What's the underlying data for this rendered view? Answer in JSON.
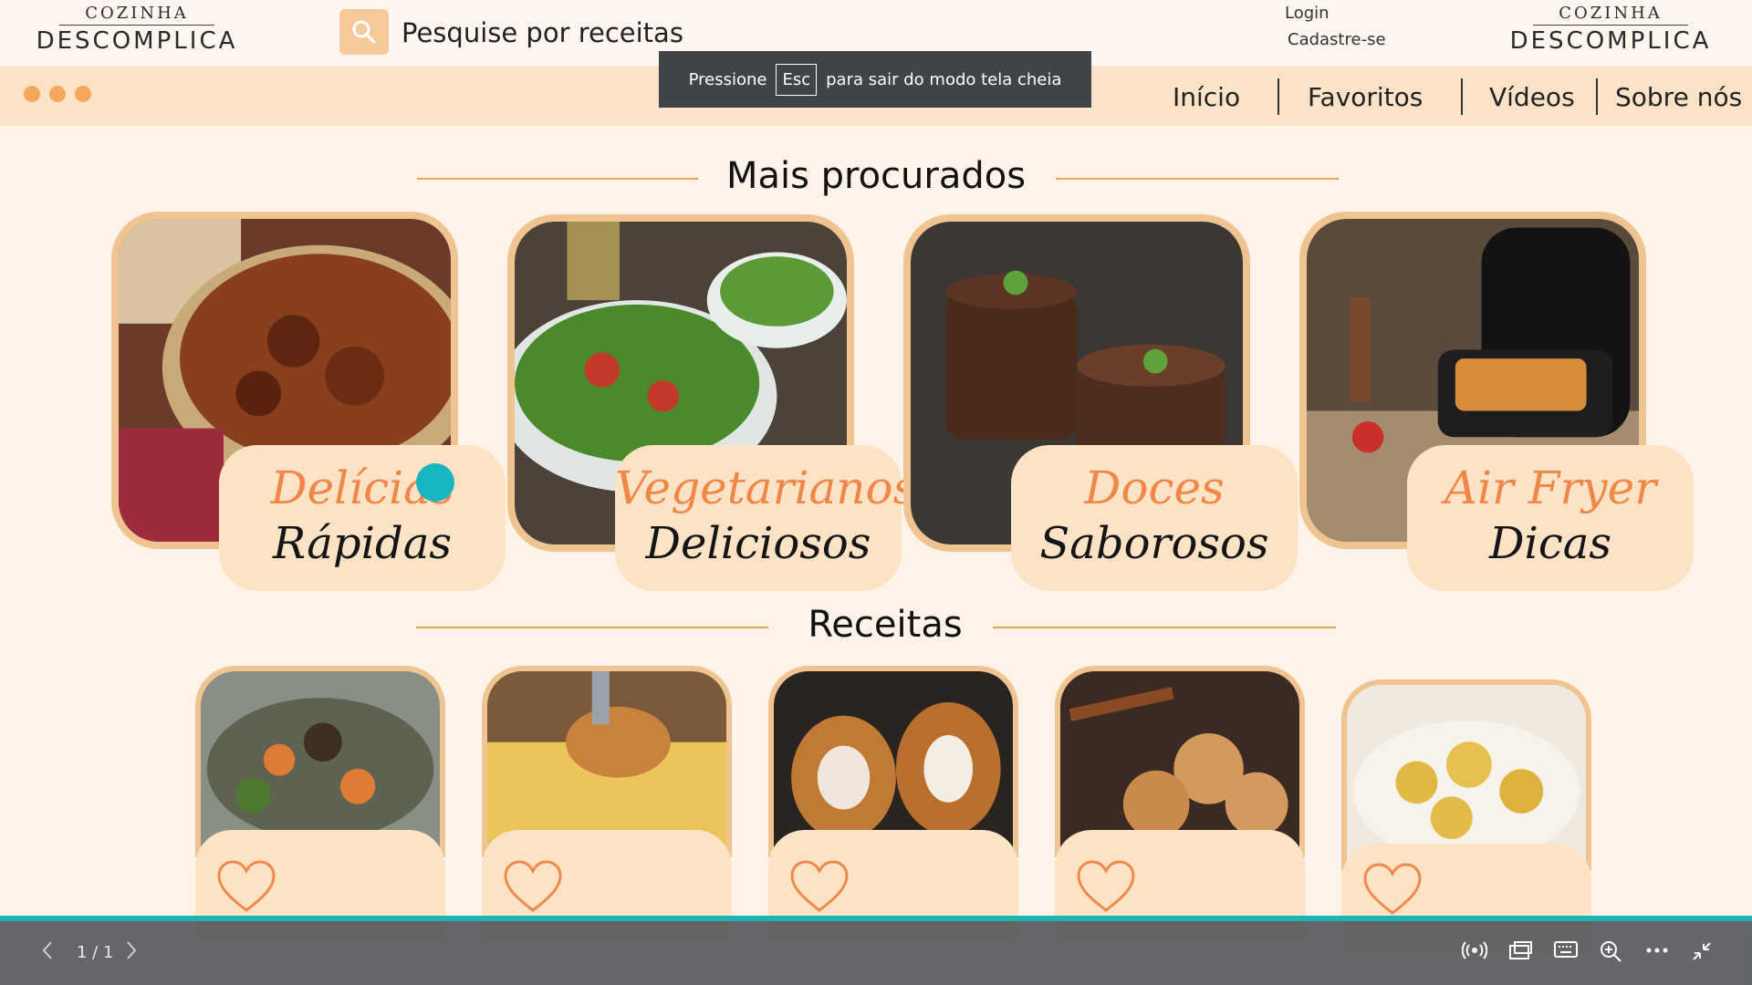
{
  "header": {
    "logo_small": "COZINHA",
    "logo_big": "DESCOMPLICA",
    "search_placeholder": "Pesquise por receitas",
    "login": "Login",
    "signup": "Cadastre-se"
  },
  "nav": {
    "items": [
      "Início",
      "Favoritos",
      "Vídeos",
      "Sobre nós"
    ]
  },
  "fullscreen_toast": {
    "before": "Pressione",
    "key": "Esc",
    "after": "para sair do modo tela cheia"
  },
  "sections": {
    "popular_title": "Mais procurados",
    "recipes_title": "Receitas"
  },
  "categories": [
    {
      "line1": "Delícias",
      "line2": "Rápidas",
      "image": "beef-stew"
    },
    {
      "line1": "Vegetarianos",
      "line2": "Deliciosos",
      "image": "green-salad"
    },
    {
      "line1": "Doces",
      "line2": "Saborosos",
      "image": "chocolate-mousse"
    },
    {
      "line1": "Air Fryer",
      "line2": "Dicas",
      "image": "air-fryer"
    }
  ],
  "recipes": [
    {
      "image": "meat-and-vegetables"
    },
    {
      "image": "chicken-lasagna"
    },
    {
      "image": "croquettes-ham-cheese"
    },
    {
      "image": "sugar-donut-balls"
    },
    {
      "image": "cheese-bread-bites"
    }
  ],
  "viewer": {
    "page": "1 / 1"
  },
  "colors": {
    "accent": "#ef8748",
    "card_border": "#f0c490",
    "label_bg": "#fde3c6",
    "teal": "#1fb3b3"
  }
}
